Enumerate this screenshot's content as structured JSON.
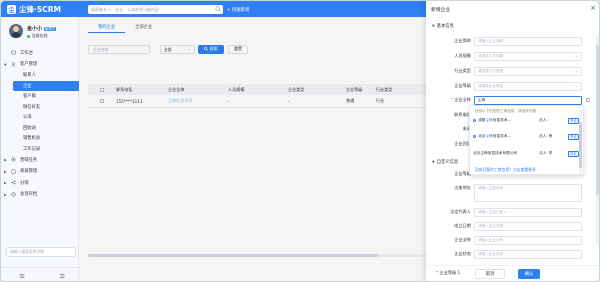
{
  "app": {
    "logo_text": "尘锋·SCRM",
    "logo_mark": "尘"
  },
  "topbar": {
    "search_placeholder": "搜索联系人、企业、公海池等功能内容",
    "quick_new": "+ 快速新增"
  },
  "profile": {
    "name": "金小小",
    "badge": "管理员",
    "status": "当前在线"
  },
  "nav": {
    "workbench": "工作台",
    "customer_mgmt": "客户管理",
    "contacts": "联系人",
    "enterprise": "企业",
    "customer_group": "客户群",
    "wechat_friends": "微信好友",
    "public_pool": "公海",
    "recycle_bin": "回收站",
    "opportunity": "销售机会",
    "work_record": "工作记录",
    "marketing": "营销任务",
    "merchant": "商城管理",
    "distribution": "分销",
    "session_archive": "会话存档",
    "search_placeholder": "请输入搜索菜单功能"
  },
  "tabs": [
    "我的企业",
    "全部企业"
  ],
  "filters": {
    "name_placeholder": "企业名称",
    "select_value": "全部",
    "search_btn": "搜索",
    "reset_btn": "重置"
  },
  "table": {
    "headers": [
      "联系电话",
      "企业全称",
      "人员规模",
      "企业类型",
      "企业等级",
      "行业类型"
    ],
    "rows": [
      [
        "155****1111",
        "尘锋信息技术",
        "-",
        "-",
        "普通",
        "行业"
      ]
    ]
  },
  "drawer": {
    "title": "新增企业",
    "close": "×",
    "section_basic": "基本信息",
    "section_custom": "自定义信息",
    "fields": [
      {
        "label": "企业简称",
        "placeholder": "请输入企业简称",
        "type": "input",
        "required": false
      },
      {
        "label": "人员规模",
        "placeholder": "请选择人员规模",
        "type": "select",
        "required": false
      },
      {
        "label": "行业类型",
        "placeholder": "请选择行业类型",
        "type": "select",
        "required": false
      },
      {
        "label": "企业等级",
        "placeholder": "请选择企业等级",
        "type": "select",
        "required": false
      },
      {
        "label": "企业全称",
        "value": "尘锋",
        "type": "input",
        "required": true
      }
    ],
    "partial_labels": [
      "联系电话",
      "来源",
      "企业团队"
    ],
    "custom_fields": [
      {
        "label": "企业等级",
        "value": "1"
      },
      {
        "label": "注册地址",
        "placeholder": "请输入注册地址"
      },
      {
        "label": "法定代表人",
        "placeholder": "请输入法定代表人"
      },
      {
        "label": "成立日期",
        "placeholder": "请输入成立日期"
      },
      {
        "label": "企业全称",
        "placeholder": "请输入企业全称"
      },
      {
        "label": "企业状态",
        "placeholder": "请输入企业状态"
      },
      {
        "label": "企业等级",
        "value": "1"
      }
    ],
    "cancel": "取消",
    "confirm": "确认"
  },
  "autocomplete": {
    "hint": "找到以下匹配的工商信息，请选择完善",
    "items": [
      {
        "prefix": "成都",
        "highlight": "尘锋",
        "suffix": "信息技术...",
        "legal": "法人: ",
        "tag": "开业"
      },
      {
        "prefix": "北京",
        "highlight": "尘锋",
        "suffix": "信息技术...",
        "legal": "法人: 蔡",
        "tag": "开业"
      },
      {
        "prefix": "北京",
        "highlight": "尘锋",
        "suffix": "信息技术有限公司",
        "legal": "法人: 李",
        "tag": "开业"
      }
    ],
    "more": "没有匹配的工商信息？点击查看更多"
  },
  "colors": {
    "brand": "#2f80f0",
    "required": "#e54545",
    "status_online": "#2fbf71"
  }
}
